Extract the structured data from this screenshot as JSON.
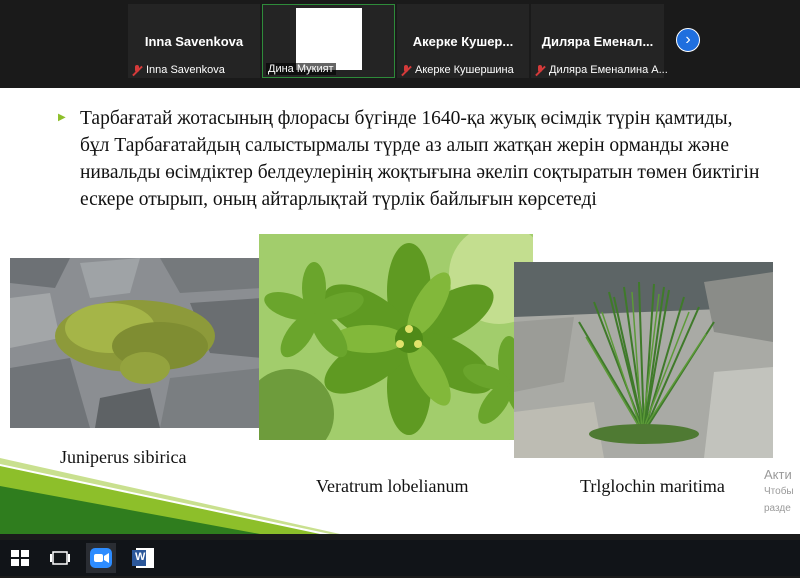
{
  "participants": [
    {
      "name": "Inna Savenkova",
      "label": "Inna Savenkova"
    },
    {
      "name": "",
      "label": "Дина Мукият"
    },
    {
      "name": "Акерке  Кушер...",
      "label": "Акерке Кушершина"
    },
    {
      "name": "Диляра  Еменал...",
      "label": "Диляра Еменалина А..."
    }
  ],
  "next_icon": "chevron-right-icon",
  "slide": {
    "paragraph": "Тарбағатай жотасының флорасы бүгінде 1640-қа жуық өсімдік түрін қамтиды, бұл Тарбағатайдың салыстырмалы түрде аз алып жатқан жерін орманды және нивальды өсімдіктер белдеулерінің жоқтығына әкеліп соқтыратын төмен биктігін ескере отырып, оның айтарлықтай түрлік байлығын көрсетеді",
    "captions": [
      "Juniperus sibirica",
      "Veratrum lobelianum",
      "Trlglochin maritima"
    ],
    "accent_color": "#8dbf2a"
  },
  "watermark": {
    "line1": "Акти",
    "line2": "Чтобы",
    "line3": "разде"
  },
  "taskbar": {
    "icons": [
      "windows-start-icon",
      "task-view-icon",
      "zoom-app-icon",
      "word-app-icon"
    ],
    "word_letter": "W"
  }
}
